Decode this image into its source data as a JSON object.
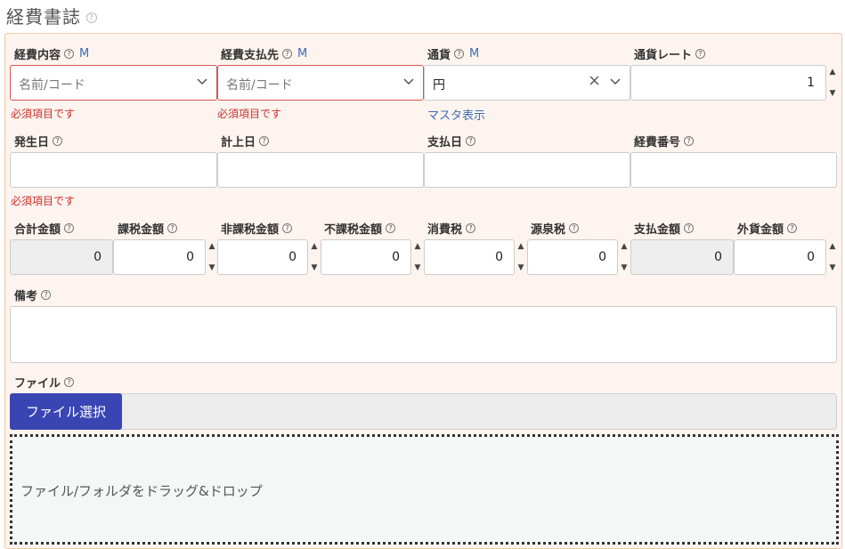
{
  "title": "経費書誌",
  "help_glyph": "?",
  "m_label": "M",
  "placeholder_name_code": "名前/コード",
  "required_msg": "必須項目です",
  "fields": {
    "expense_content": {
      "label": "経費内容"
    },
    "payee": {
      "label": "経費支払先"
    },
    "currency": {
      "label": "通貨",
      "value": "円",
      "master_link": "マスタ表示"
    },
    "rate": {
      "label": "通貨レート",
      "value": "1"
    },
    "occurrence_date": {
      "label": "発生日"
    },
    "posting_date": {
      "label": "計上日"
    },
    "payment_date": {
      "label": "支払日"
    },
    "expense_number": {
      "label": "経費番号"
    },
    "total": {
      "label": "合計金額",
      "value": "0"
    },
    "taxable": {
      "label": "課税金額",
      "value": "0"
    },
    "non_taxable": {
      "label": "非課税金額",
      "value": "0"
    },
    "tax_exempt": {
      "label": "不課税金額",
      "value": "0"
    },
    "consumption_tax": {
      "label": "消費税",
      "value": "0"
    },
    "withholding_tax": {
      "label": "源泉税",
      "value": "0"
    },
    "payment_amount": {
      "label": "支払金額",
      "value": "0"
    },
    "foreign_amount": {
      "label": "外貨金額",
      "value": "0"
    },
    "remarks": {
      "label": "備考"
    },
    "file": {
      "label": "ファイル",
      "button": "ファイル選択",
      "drop_text": "ファイル/フォルダをドラッグ&ドロップ"
    }
  },
  "icons": {
    "chevron": "chevron-down-icon",
    "clear": "close-icon",
    "spin_up": "▲",
    "spin_down": "▼"
  },
  "colors": {
    "panel_bg": "#fdf4ef",
    "panel_border": "#f1c9a2",
    "error": "#d9534f",
    "link": "#3b6cb5",
    "file_button": "#3a45b4"
  }
}
